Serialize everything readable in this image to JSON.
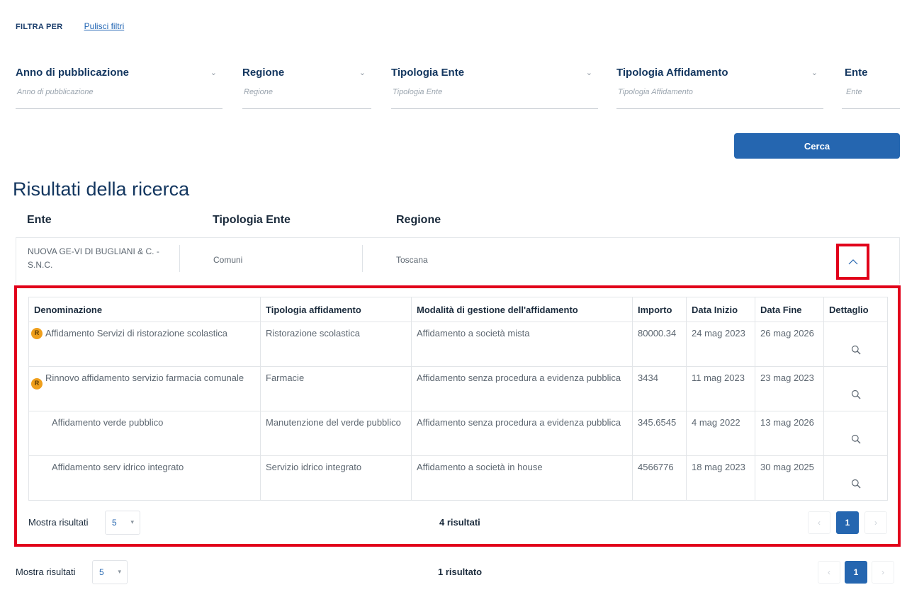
{
  "filters": {
    "heading": "FILTRA PER",
    "clear": "Pulisci filtri",
    "fields": [
      {
        "label": "Anno di pubblicazione",
        "placeholder": "Anno di pubblicazione"
      },
      {
        "label": "Regione",
        "placeholder": "Regione"
      },
      {
        "label": "Tipologia Ente",
        "placeholder": "Tipologia Ente"
      },
      {
        "label": "Tipologia Affidamento",
        "placeholder": "Tipologia Affidamento"
      },
      {
        "label": "Ente",
        "placeholder": "Ente"
      }
    ],
    "caret_icon": "chevron-down-icon",
    "search_button": "Cerca"
  },
  "results": {
    "title": "Risultati della ricerca",
    "columns": [
      "Ente",
      "Tipologia Ente",
      "Regione"
    ],
    "row": {
      "ente": "NUOVA GE-VI DI BUGLIANI & C. - S.N.C.",
      "tipologia": "Comuni",
      "regione": "Toscana",
      "toggle_icon": "chevron-up-icon"
    },
    "detail_table": {
      "headers": [
        "Denominazione",
        "Tipologia affidamento",
        "Modalità di gestione dell'affidamento",
        "Importo",
        "Data Inizio",
        "Data Fine",
        "Dettaglio"
      ],
      "rows": [
        {
          "badge": "R",
          "denominazione": "Affidamento Servizi di ristorazione scolastica",
          "tipologia": "Ristorazione scolastica",
          "modalita": "Affidamento a società mista",
          "importo": "80000.34",
          "inizio": "24 mag 2023",
          "fine": "26 mag 2026"
        },
        {
          "badge": "R",
          "denominazione": "Rinnovo affidamento servizio farmacia comunale",
          "tipologia": "Farmacie",
          "modalita": "Affidamento senza procedura a evidenza pubblica",
          "importo": "3434",
          "inizio": "11 mag 2023",
          "fine": "23 mag 2023"
        },
        {
          "badge": "",
          "denominazione": "Affidamento verde pubblico",
          "tipologia": "Manutenzione del verde pubblico",
          "modalita": "Affidamento senza procedura a evidenza pubblica",
          "importo": "345.6545",
          "inizio": "4 mag 2022",
          "fine": "13 mag 2026"
        },
        {
          "badge": "",
          "denominazione": "Affidamento serv idrico integrato",
          "tipologia": "Servizio idrico integrato",
          "modalita": "Affidamento a società in house",
          "importo": "4566776",
          "inizio": "18 mag 2023",
          "fine": "30 mag 2025"
        }
      ],
      "detail_icon": "search-icon"
    },
    "inner_pager": {
      "label": "Mostra risultati",
      "per_page": "5",
      "count": "4 risultati",
      "prev": "‹",
      "page": "1",
      "next": "›"
    },
    "outer_pager": {
      "label": "Mostra risultati",
      "per_page": "5",
      "count": "1 risultato",
      "prev": "‹",
      "page": "1",
      "next": "›"
    }
  },
  "colors": {
    "accent": "#2566b0",
    "highlight": "#e1001a",
    "badge": "#ef9f1c"
  }
}
